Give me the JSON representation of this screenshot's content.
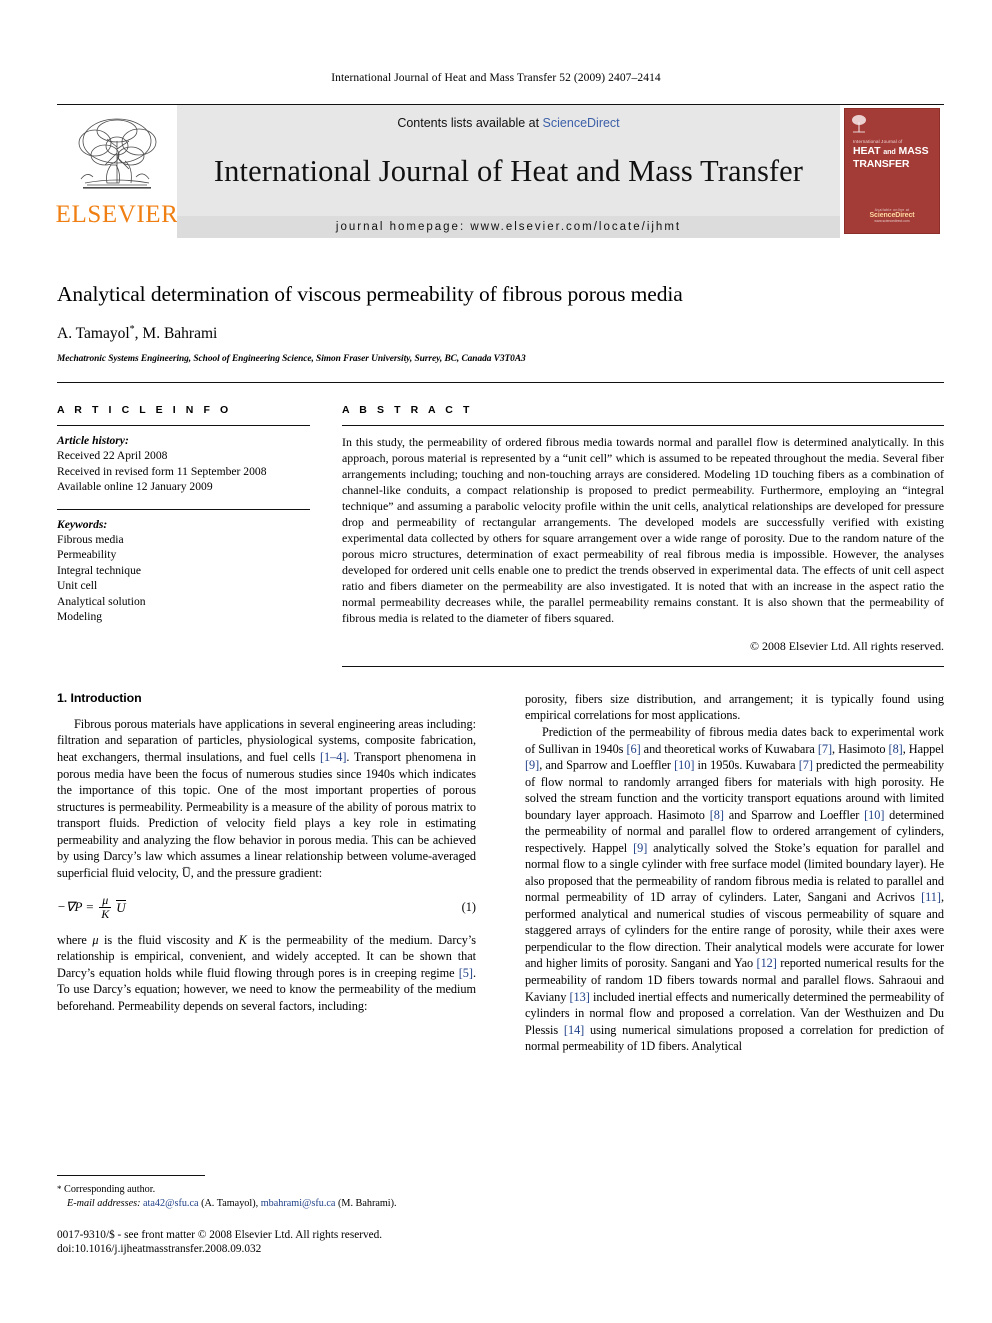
{
  "running_head": "International Journal of Heat and Mass Transfer 52 (2009) 2407–2414",
  "masthead": {
    "contents_prefix": "Contents lists available at ",
    "contents_link": "ScienceDirect",
    "journal_name": "International Journal of Heat and Mass Transfer",
    "homepage": "journal homepage: www.elsevier.com/locate/ijhmt",
    "publisher_word": "ELSEVIER",
    "cover": {
      "sub": "International Journal of",
      "line1": "HEAT",
      "line_and": "and",
      "line2": "MASS",
      "line3": "TRANSFER",
      "foot1": "Available online at",
      "foot2": "ScienceDirect",
      "foot3": "www.sciencedirect.com"
    }
  },
  "article": {
    "title": "Analytical determination of viscous permeability of fibrous porous media",
    "authors": "A. Tamayol",
    "authors_mark": "*",
    "authors_rest": ", M. Bahrami",
    "affiliation": "Mechatronic Systems Engineering, School of Engineering Science, Simon Fraser University, Surrey, BC, Canada V3T0A3"
  },
  "info": {
    "heading": "A R T I C L E    I N F O",
    "history_label": "Article history:",
    "history": [
      "Received 22 April 2008",
      "Received in revised form 11 September 2008",
      "Available online 12 January 2009"
    ],
    "keywords_label": "Keywords:",
    "keywords": [
      "Fibrous media",
      "Permeability",
      "Integral technique",
      "Unit cell",
      "Analytical solution",
      "Modeling"
    ]
  },
  "abstract": {
    "heading": "A B S T R A C T",
    "text": "In this study, the permeability of ordered fibrous media towards normal and parallel flow is determined analytically. In this approach, porous material is represented by a “unit cell” which is assumed to be repeated throughout the media. Several fiber arrangements including; touching and non-touching arrays are considered. Modeling 1D touching fibers as a combination of channel-like conduits, a compact relationship is proposed to predict permeability. Furthermore, employing an “integral technique” and assuming a parabolic velocity profile within the unit cells, analytical relationships are developed for pressure drop and permeability of rectangular arrangements. The developed models are successfully verified with existing experimental data collected by others for square arrangement over a wide range of porosity. Due to the random nature of the porous micro structures, determination of exact permeability of real fibrous media is impossible. However, the analyses developed for ordered unit cells enable one to predict the trends observed in experimental data. The effects of unit cell aspect ratio and fibers diameter on the permeability are also investigated. It is noted that with an increase in the aspect ratio the normal permeability decreases while, the parallel permeability remains constant. It is also shown that the permeability of fibrous media is related to the diameter of fibers squared.",
    "copyright": "© 2008 Elsevier Ltd. All rights reserved."
  },
  "sections": {
    "introduction_heading": "1. Introduction"
  },
  "left_column": {
    "para1_a": "Fibrous porous materials have applications in several engineering areas including: filtration and separation of particles, physiological systems, composite fabrication, heat exchangers, thermal insulations, and fuel cells ",
    "ref1": "[1–4]",
    "para1_b": ". Transport phenomena in porous media have been the focus of numerous studies since 1940s which indicates the importance of this topic. One of the most important properties of porous structures is permeability. Permeability is a measure of the ability of porous matrix to transport fluids. Prediction of velocity field plays a key role in estimating permeability and analyzing the flow behavior in porous media. This can be achieved by using Darcy’s law which assumes a linear relationship between volume-averaged superficial fluid velocity, ",
    "para1_sym": "U̅",
    "para1_c": ", and the pressure gradient:",
    "equation": {
      "minus_grad": "−∇P =",
      "num": "μ",
      "den": "K",
      "vel": "U",
      "number": "(1)"
    },
    "para2_a": "where ",
    "para2_mu": "μ",
    "para2_b": " is the fluid viscosity and ",
    "para2_K": "K",
    "para2_c": " is the permeability of the medium. Darcy’s relationship is empirical, convenient, and widely accepted. It can be shown that Darcy’s equation holds while fluid flowing through pores is in creeping regime ",
    "ref5": "[5]",
    "para2_d": ". To use Darcy’s equation; however, we need to know the permeability of the medium beforehand. Permeability depends on several factors, including:"
  },
  "right_column": {
    "para_cont": "porosity, fibers size distribution, and arrangement; it is typically found using empirical correlations for most applications.",
    "para_a": "Prediction of the permeability of fibrous media dates back to experimental work of Sullivan in 1940s ",
    "r6": "[6]",
    "para_b": " and theoretical works of Kuwabara ",
    "r7": "[7]",
    "para_c": ", Hasimoto ",
    "r8": "[8]",
    "para_d": ", Happel ",
    "r9": "[9]",
    "para_e": ", and Sparrow and Loeffler ",
    "r10": "[10]",
    "para_f": " in 1950s. Kuwabara ",
    "r7b": "[7]",
    "para_g": " predicted the permeability of flow normal to randomly arranged fibers for materials with high porosity. He solved the stream function and the vorticity transport equations around with limited boundary layer approach. Hasimoto ",
    "r8b": "[8]",
    "para_h": " and Sparrow and Loeffler ",
    "r10b": "[10]",
    "para_i": " determined the permeability of normal and parallel flow to ordered arrangement of cylinders, respectively. Happel ",
    "r9b": "[9]",
    "para_j": " analytically solved the Stoke’s equation for parallel and normal flow to a single cylinder with free surface model (limited boundary layer). He also proposed that the permeability of random fibrous media is related to parallel and normal permeability of 1D array of cylinders. Later, Sangani and Acrivos ",
    "r11": "[11]",
    "para_k": ", performed analytical and numerical studies of viscous permeability of square and staggered arrays of cylinders for the entire range of porosity, while their axes were perpendicular to the flow direction. Their analytical models were accurate for lower and higher limits of porosity. Sangani and Yao ",
    "r12": "[12]",
    "para_l": " reported numerical results for the permeability of random 1D fibers towards normal and parallel flows. Sahraoui and Kaviany ",
    "r13": "[13]",
    "para_m": " included inertial effects and numerically determined the permeability of cylinders in normal flow and proposed a correlation. Van der Westhuizen and Du Plessis ",
    "r14": "[14]",
    "para_n": " using numerical simulations proposed a correlation for prediction of normal permeability of 1D fibers. Analytical"
  },
  "footnote": {
    "star": "*",
    "corresponding": " Corresponding author.",
    "email_label": "E-mail addresses:",
    "email1": "ata42@sfu.ca",
    "email1_owner": " (A. Tamayol), ",
    "email2": "mbahrami@sfu.ca",
    "email2_owner": " (M. Bahrami)."
  },
  "imprint": {
    "line1": "0017-9310/$ - see front matter © 2008 Elsevier Ltd. All rights reserved.",
    "line2": "doi:10.1016/j.ijheatmasstransfer.2008.09.032"
  }
}
